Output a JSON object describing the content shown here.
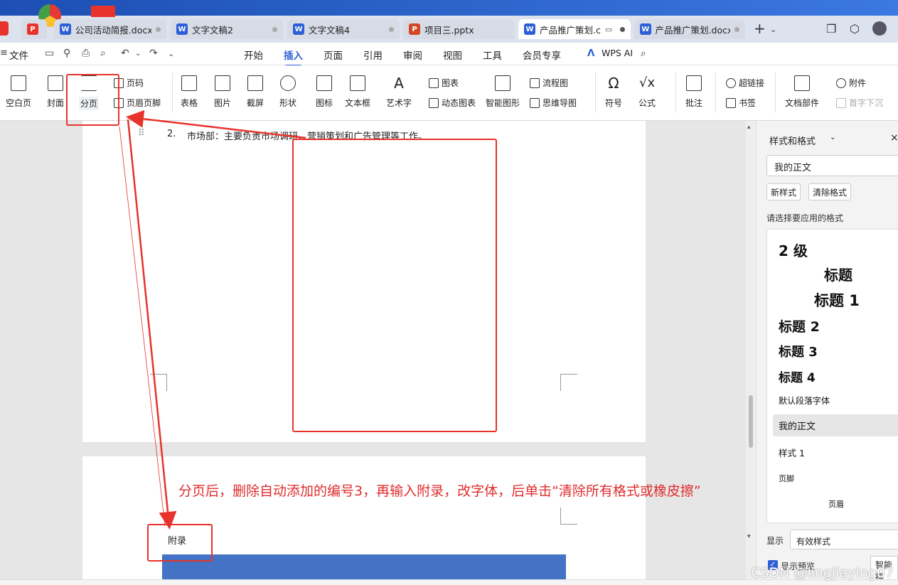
{
  "tabs": [
    {
      "label": "公司活动简报.docx",
      "type": "W"
    },
    {
      "label": "文字文稿2",
      "type": "W"
    },
    {
      "label": "文字文稿4",
      "type": "W"
    },
    {
      "label": "项目三.pptx",
      "type": "P"
    },
    {
      "label": "产品推广策划.c",
      "type": "W"
    },
    {
      "label": "产品推广策划.docx",
      "type": "W"
    }
  ],
  "menu": {
    "file": "文件",
    "items": [
      "开始",
      "插入",
      "页面",
      "引用",
      "审阅",
      "视图",
      "工具",
      "会员专享"
    ],
    "wps_ai": "WPS AI"
  },
  "ribbon": {
    "blank_page": "空白页",
    "cover": "封面",
    "page_break": "分页",
    "page_number": "页码",
    "header_footer": "页眉页脚",
    "table": "表格",
    "picture": "图片",
    "screenshot": "截屏",
    "shape": "形状",
    "icon": "图标",
    "textbox": "文本框",
    "wordart": "艺术字",
    "chart": "图表",
    "dynamic_chart": "动态图表",
    "smart_graphic": "智能图形",
    "flowchart": "流程图",
    "mindmap": "思维导图",
    "symbol": "符号",
    "formula": "公式",
    "comment": "批注",
    "hyperlink": "超链接",
    "bookmark": "书签",
    "doc_parts": "文档部件",
    "attachment": "附件",
    "dropcap": "首字下沉"
  },
  "document": {
    "list_number": "2.",
    "line_text": "市场部：主要负责市场调研、营销策划和广告管理等工作。",
    "appendix": "附录"
  },
  "annotation": "分页后，删除自动添加的编号3，再输入附录，改字体，后单击“清除所有格式或橡皮擦”",
  "side_panel": {
    "title": "样式和格式",
    "current_style": "我的正文",
    "new_style": "新样式",
    "clear_format": "清除格式",
    "hint": "请选择要应用的格式",
    "styles": [
      "2 级",
      "标题",
      "标题 1",
      "标题 2",
      "标题 3",
      "标题 4",
      "默认段落字体",
      "我的正文",
      "样式 1",
      "页脚",
      "页眉"
    ],
    "show_label": "显示",
    "show_value": "有效样式",
    "preview_label": "显示预览",
    "smart_label": "智能排"
  },
  "watermark": "CSDN @lingjiaying07",
  "colors": {
    "accent": "#2d5fd6",
    "annotation": "#e8322c",
    "appendix_bar": "#4472c4"
  }
}
